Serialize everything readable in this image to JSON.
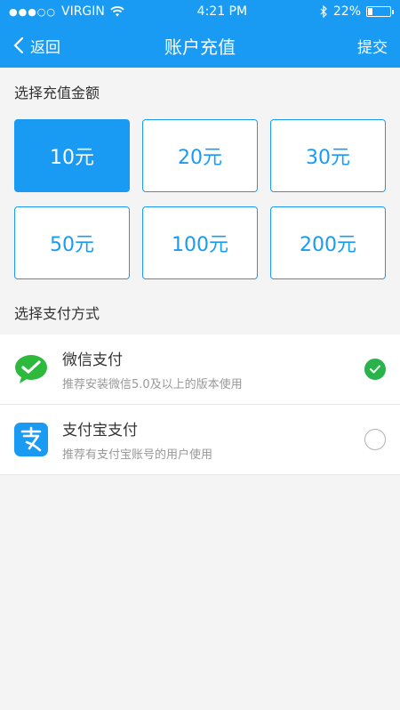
{
  "status": {
    "carrier": "VIRGIN",
    "time": "4:21 PM",
    "battery": "22%",
    "battery_level": 0.22
  },
  "nav": {
    "back_label": "返回",
    "title": "账户充值",
    "submit_label": "提交"
  },
  "amount": {
    "label": "选择充值金额",
    "options": [
      "10元",
      "20元",
      "30元",
      "50元",
      "100元",
      "200元"
    ],
    "selected_index": 0
  },
  "payment": {
    "label": "选择支付方式",
    "methods": [
      {
        "name": "微信支付",
        "desc": "推荐安装微信5.0及以上的版本使用",
        "icon": "wechat-icon",
        "selected": true
      },
      {
        "name": "支付宝支付",
        "desc": "推荐有支付宝账号的用户使用",
        "icon": "alipay-icon",
        "selected": false
      }
    ]
  },
  "colors": {
    "primary": "#1a9bf3",
    "check": "#29b34a"
  }
}
